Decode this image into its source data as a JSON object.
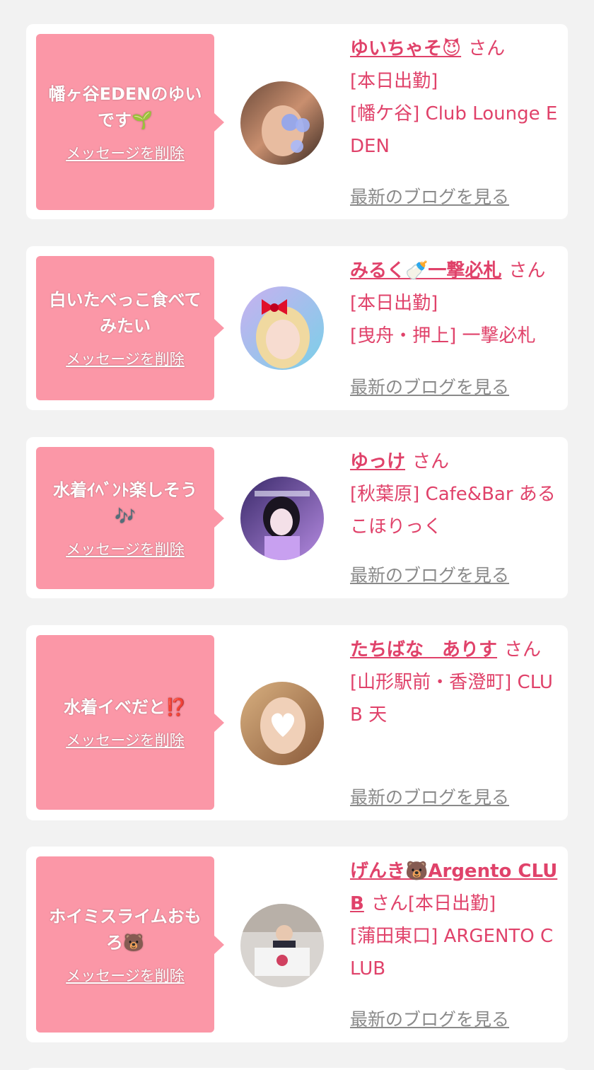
{
  "accent_color": "#e0426a",
  "bubble_color": "#fb97a7",
  "link_gray": "#8a8a8a",
  "honorific": "さん",
  "delete_label": "メッセージを削除",
  "blog_label": "最新のブログを見る",
  "cards": [
    {
      "message": "幡ヶ谷EDENのゆいです🌱",
      "name": "ゆいちゃそ😈",
      "status": "[本日出勤]",
      "shop": "[幡ケ谷] Club Lounge EDEN"
    },
    {
      "message": "白いたべっこ食べてみたい",
      "name": "みるく🍼一撃必札",
      "status": "[本日出勤]",
      "shop": "[曳舟・押上] 一撃必札"
    },
    {
      "message": "水着ｲﾍﾞﾝﾄ楽しそう🎶",
      "name": "ゆっけ",
      "status": "",
      "shop": "[秋葉原] Cafe&Bar あるこほりっく"
    },
    {
      "message": "水着イベだと⁉️",
      "name": "たちばな　ありす",
      "status": "",
      "shop": "[山形駅前・香澄町] CLUB 天"
    },
    {
      "message": "ホイミスライムおもろ🐻",
      "name": "げんき🐻Argento CLUB",
      "status": "[本日出勤]",
      "shop": "[蒲田東口] ARGENTO CLUB"
    }
  ]
}
